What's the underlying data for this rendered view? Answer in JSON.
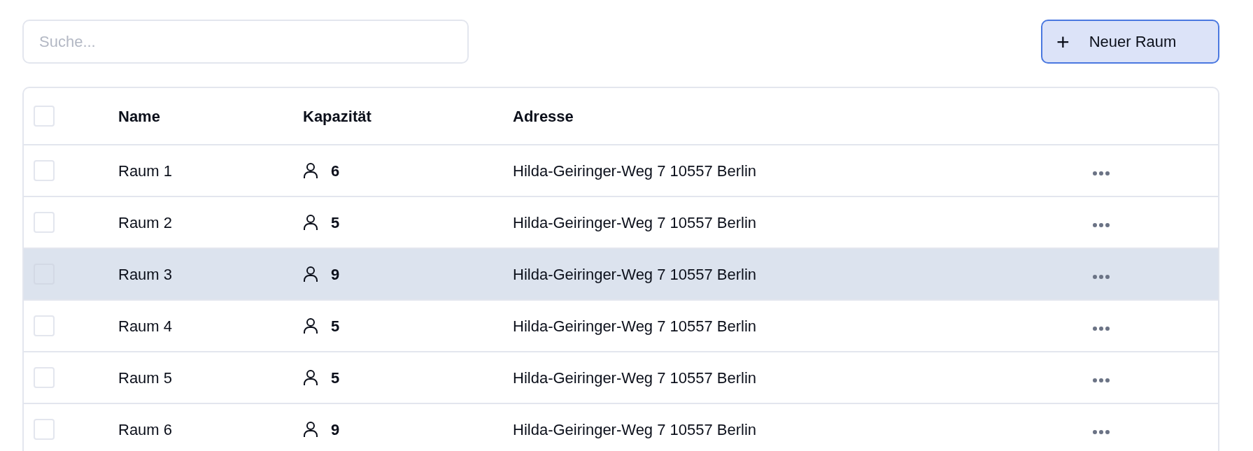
{
  "search": {
    "placeholder": "Suche..."
  },
  "new_button": {
    "icon": "+",
    "label": "Neuer Raum"
  },
  "table": {
    "header_checkbox": {
      "checked": false
    },
    "columns": [
      "Name",
      "Kapazität",
      "Adresse"
    ],
    "rows": [
      {
        "name": "Raum 1",
        "capacity": "6",
        "address": "Hilda-Geiringer-Weg 7 10557 Berlin",
        "checked": false,
        "selected": false
      },
      {
        "name": "Raum 2",
        "capacity": "5",
        "address": "Hilda-Geiringer-Weg 7 10557 Berlin",
        "checked": false,
        "selected": false
      },
      {
        "name": "Raum 3",
        "capacity": "9",
        "address": "Hilda-Geiringer-Weg 7 10557 Berlin",
        "checked": false,
        "selected": true
      },
      {
        "name": "Raum 4",
        "capacity": "5",
        "address": "Hilda-Geiringer-Weg 7 10557 Berlin",
        "checked": false,
        "selected": false
      },
      {
        "name": "Raum 5",
        "capacity": "5",
        "address": "Hilda-Geiringer-Weg 7 10557 Berlin",
        "checked": false,
        "selected": false
      },
      {
        "name": "Raum 6",
        "capacity": "9",
        "address": "Hilda-Geiringer-Weg 7 10557 Berlin",
        "checked": false,
        "selected": false
      }
    ]
  }
}
